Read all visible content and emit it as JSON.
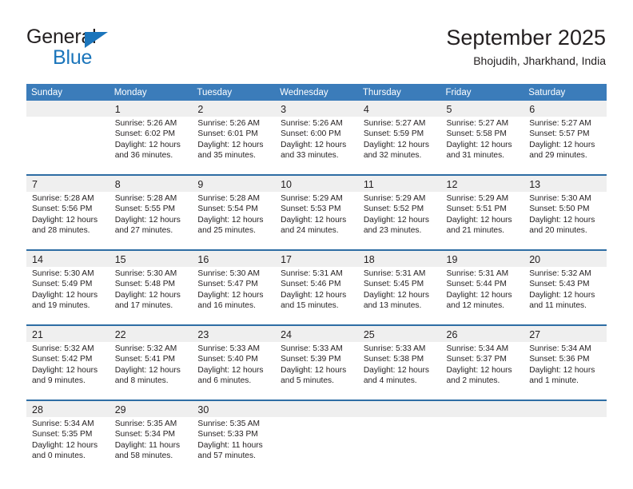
{
  "brand": {
    "line1": "General",
    "line2": "Blue",
    "triangle_color": "#1b75bb"
  },
  "header": {
    "title": "September 2025",
    "subtitle": "Bhojudih, Jharkhand, India"
  },
  "theme": {
    "header_blue": "#3b7cba",
    "separator_blue": "#2e6da4",
    "daynum_band": "#efefef",
    "text": "#231f20"
  },
  "calendar": {
    "weekday_headers": [
      "Sunday",
      "Monday",
      "Tuesday",
      "Wednesday",
      "Thursday",
      "Friday",
      "Saturday"
    ],
    "weeks": [
      [
        {
          "day": "",
          "lines": []
        },
        {
          "day": "1",
          "lines": [
            "Sunrise: 5:26 AM",
            "Sunset: 6:02 PM",
            "Daylight: 12 hours",
            "and 36 minutes."
          ]
        },
        {
          "day": "2",
          "lines": [
            "Sunrise: 5:26 AM",
            "Sunset: 6:01 PM",
            "Daylight: 12 hours",
            "and 35 minutes."
          ]
        },
        {
          "day": "3",
          "lines": [
            "Sunrise: 5:26 AM",
            "Sunset: 6:00 PM",
            "Daylight: 12 hours",
            "and 33 minutes."
          ]
        },
        {
          "day": "4",
          "lines": [
            "Sunrise: 5:27 AM",
            "Sunset: 5:59 PM",
            "Daylight: 12 hours",
            "and 32 minutes."
          ]
        },
        {
          "day": "5",
          "lines": [
            "Sunrise: 5:27 AM",
            "Sunset: 5:58 PM",
            "Daylight: 12 hours",
            "and 31 minutes."
          ]
        },
        {
          "day": "6",
          "lines": [
            "Sunrise: 5:27 AM",
            "Sunset: 5:57 PM",
            "Daylight: 12 hours",
            "and 29 minutes."
          ]
        }
      ],
      [
        {
          "day": "7",
          "lines": [
            "Sunrise: 5:28 AM",
            "Sunset: 5:56 PM",
            "Daylight: 12 hours",
            "and 28 minutes."
          ]
        },
        {
          "day": "8",
          "lines": [
            "Sunrise: 5:28 AM",
            "Sunset: 5:55 PM",
            "Daylight: 12 hours",
            "and 27 minutes."
          ]
        },
        {
          "day": "9",
          "lines": [
            "Sunrise: 5:28 AM",
            "Sunset: 5:54 PM",
            "Daylight: 12 hours",
            "and 25 minutes."
          ]
        },
        {
          "day": "10",
          "lines": [
            "Sunrise: 5:29 AM",
            "Sunset: 5:53 PM",
            "Daylight: 12 hours",
            "and 24 minutes."
          ]
        },
        {
          "day": "11",
          "lines": [
            "Sunrise: 5:29 AM",
            "Sunset: 5:52 PM",
            "Daylight: 12 hours",
            "and 23 minutes."
          ]
        },
        {
          "day": "12",
          "lines": [
            "Sunrise: 5:29 AM",
            "Sunset: 5:51 PM",
            "Daylight: 12 hours",
            "and 21 minutes."
          ]
        },
        {
          "day": "13",
          "lines": [
            "Sunrise: 5:30 AM",
            "Sunset: 5:50 PM",
            "Daylight: 12 hours",
            "and 20 minutes."
          ]
        }
      ],
      [
        {
          "day": "14",
          "lines": [
            "Sunrise: 5:30 AM",
            "Sunset: 5:49 PM",
            "Daylight: 12 hours",
            "and 19 minutes."
          ]
        },
        {
          "day": "15",
          "lines": [
            "Sunrise: 5:30 AM",
            "Sunset: 5:48 PM",
            "Daylight: 12 hours",
            "and 17 minutes."
          ]
        },
        {
          "day": "16",
          "lines": [
            "Sunrise: 5:30 AM",
            "Sunset: 5:47 PM",
            "Daylight: 12 hours",
            "and 16 minutes."
          ]
        },
        {
          "day": "17",
          "lines": [
            "Sunrise: 5:31 AM",
            "Sunset: 5:46 PM",
            "Daylight: 12 hours",
            "and 15 minutes."
          ]
        },
        {
          "day": "18",
          "lines": [
            "Sunrise: 5:31 AM",
            "Sunset: 5:45 PM",
            "Daylight: 12 hours",
            "and 13 minutes."
          ]
        },
        {
          "day": "19",
          "lines": [
            "Sunrise: 5:31 AM",
            "Sunset: 5:44 PM",
            "Daylight: 12 hours",
            "and 12 minutes."
          ]
        },
        {
          "day": "20",
          "lines": [
            "Sunrise: 5:32 AM",
            "Sunset: 5:43 PM",
            "Daylight: 12 hours",
            "and 11 minutes."
          ]
        }
      ],
      [
        {
          "day": "21",
          "lines": [
            "Sunrise: 5:32 AM",
            "Sunset: 5:42 PM",
            "Daylight: 12 hours",
            "and 9 minutes."
          ]
        },
        {
          "day": "22",
          "lines": [
            "Sunrise: 5:32 AM",
            "Sunset: 5:41 PM",
            "Daylight: 12 hours",
            "and 8 minutes."
          ]
        },
        {
          "day": "23",
          "lines": [
            "Sunrise: 5:33 AM",
            "Sunset: 5:40 PM",
            "Daylight: 12 hours",
            "and 6 minutes."
          ]
        },
        {
          "day": "24",
          "lines": [
            "Sunrise: 5:33 AM",
            "Sunset: 5:39 PM",
            "Daylight: 12 hours",
            "and 5 minutes."
          ]
        },
        {
          "day": "25",
          "lines": [
            "Sunrise: 5:33 AM",
            "Sunset: 5:38 PM",
            "Daylight: 12 hours",
            "and 4 minutes."
          ]
        },
        {
          "day": "26",
          "lines": [
            "Sunrise: 5:34 AM",
            "Sunset: 5:37 PM",
            "Daylight: 12 hours",
            "and 2 minutes."
          ]
        },
        {
          "day": "27",
          "lines": [
            "Sunrise: 5:34 AM",
            "Sunset: 5:36 PM",
            "Daylight: 12 hours",
            "and 1 minute."
          ]
        }
      ],
      [
        {
          "day": "28",
          "lines": [
            "Sunrise: 5:34 AM",
            "Sunset: 5:35 PM",
            "Daylight: 12 hours",
            "and 0 minutes."
          ]
        },
        {
          "day": "29",
          "lines": [
            "Sunrise: 5:35 AM",
            "Sunset: 5:34 PM",
            "Daylight: 11 hours",
            "and 58 minutes."
          ]
        },
        {
          "day": "30",
          "lines": [
            "Sunrise: 5:35 AM",
            "Sunset: 5:33 PM",
            "Daylight: 11 hours",
            "and 57 minutes."
          ]
        },
        {
          "day": "",
          "lines": []
        },
        {
          "day": "",
          "lines": []
        },
        {
          "day": "",
          "lines": []
        },
        {
          "day": "",
          "lines": []
        }
      ]
    ]
  }
}
